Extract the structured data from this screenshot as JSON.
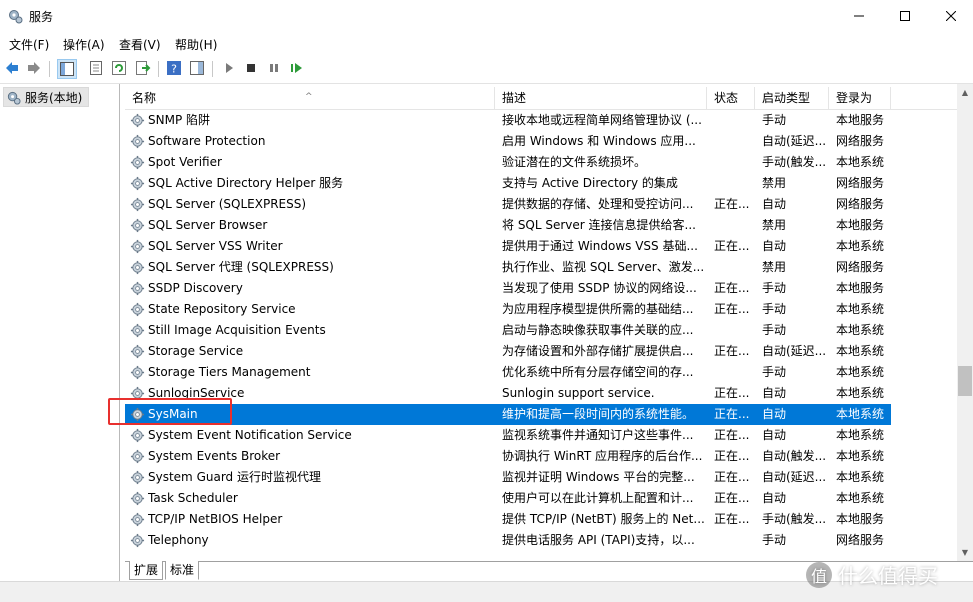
{
  "window": {
    "title": "服务"
  },
  "menu": [
    "文件(F)",
    "操作(A)",
    "查看(V)",
    "帮助(H)"
  ],
  "tree": {
    "item": "服务(本地)"
  },
  "columns": [
    "名称",
    "描述",
    "状态",
    "启动类型",
    "登录为"
  ],
  "rows": [
    {
      "name": "SNMP 陷阱",
      "desc": "接收本地或远程简单网络管理协议 (...",
      "status": "",
      "startup": "手动",
      "logon": "本地服务"
    },
    {
      "name": "Software Protection",
      "desc": "启用 Windows 和 Windows 应用...",
      "status": "",
      "startup": "自动(延迟...",
      "logon": "网络服务"
    },
    {
      "name": "Spot Verifier",
      "desc": "验证潜在的文件系统损坏。",
      "status": "",
      "startup": "手动(触发...",
      "logon": "本地系统"
    },
    {
      "name": "SQL Active Directory Helper 服务",
      "desc": "支持与 Active Directory 的集成",
      "status": "",
      "startup": "禁用",
      "logon": "网络服务"
    },
    {
      "name": "SQL Server (SQLEXPRESS)",
      "desc": "提供数据的存储、处理和受控访问...",
      "status": "正在...",
      "startup": "自动",
      "logon": "网络服务"
    },
    {
      "name": "SQL Server Browser",
      "desc": "将 SQL Server 连接信息提供给客...",
      "status": "",
      "startup": "禁用",
      "logon": "本地服务"
    },
    {
      "name": "SQL Server VSS Writer",
      "desc": "提供用于通过 Windows VSS 基础...",
      "status": "正在...",
      "startup": "自动",
      "logon": "本地系统"
    },
    {
      "name": "SQL Server 代理 (SQLEXPRESS)",
      "desc": "执行作业、监视 SQL Server、激发...",
      "status": "",
      "startup": "禁用",
      "logon": "网络服务"
    },
    {
      "name": "SSDP Discovery",
      "desc": "当发现了使用 SSDP 协议的网络设...",
      "status": "正在...",
      "startup": "手动",
      "logon": "本地服务"
    },
    {
      "name": "State Repository Service",
      "desc": "为应用程序模型提供所需的基础结...",
      "status": "正在...",
      "startup": "手动",
      "logon": "本地系统"
    },
    {
      "name": "Still Image Acquisition Events",
      "desc": "启动与静态映像获取事件关联的应...",
      "status": "",
      "startup": "手动",
      "logon": "本地系统"
    },
    {
      "name": "Storage Service",
      "desc": "为存储设置和外部存储扩展提供启...",
      "status": "正在...",
      "startup": "自动(延迟...",
      "logon": "本地系统"
    },
    {
      "name": "Storage Tiers Management",
      "desc": "优化系统中所有分层存储空间的存...",
      "status": "",
      "startup": "手动",
      "logon": "本地系统"
    },
    {
      "name": "SunloginService",
      "desc": "Sunlogin support service.",
      "status": "正在...",
      "startup": "自动",
      "logon": "本地系统"
    },
    {
      "name": "SysMain",
      "desc": "维护和提高一段时间内的系统性能。",
      "status": "正在...",
      "startup": "自动",
      "logon": "本地系统"
    },
    {
      "name": "System Event Notification Service",
      "desc": "监视系统事件并通知订户这些事件...",
      "status": "正在...",
      "startup": "自动",
      "logon": "本地系统"
    },
    {
      "name": "System Events Broker",
      "desc": "协调执行 WinRT 应用程序的后台作...",
      "status": "正在...",
      "startup": "自动(触发...",
      "logon": "本地系统"
    },
    {
      "name": "System Guard 运行时监视代理",
      "desc": "监视并证明 Windows 平台的完整...",
      "status": "正在...",
      "startup": "自动(延迟...",
      "logon": "本地系统"
    },
    {
      "name": "Task Scheduler",
      "desc": "使用户可以在此计算机上配置和计...",
      "status": "正在...",
      "startup": "自动",
      "logon": "本地系统"
    },
    {
      "name": "TCP/IP NetBIOS Helper",
      "desc": "提供 TCP/IP (NetBT) 服务上的 Net...",
      "status": "正在...",
      "startup": "手动(触发...",
      "logon": "本地服务"
    },
    {
      "name": "Telephony",
      "desc": "提供电话服务 API (TAPI)支持，以...",
      "status": "",
      "startup": "手动",
      "logon": "网络服务"
    }
  ],
  "selected_index": 14,
  "tabs": [
    "扩展",
    "标准"
  ],
  "watermark": {
    "logo": "值",
    "text": "什么值得买"
  },
  "colors": {
    "selection": "#0078d7",
    "highlight_box": "#e8302e"
  }
}
